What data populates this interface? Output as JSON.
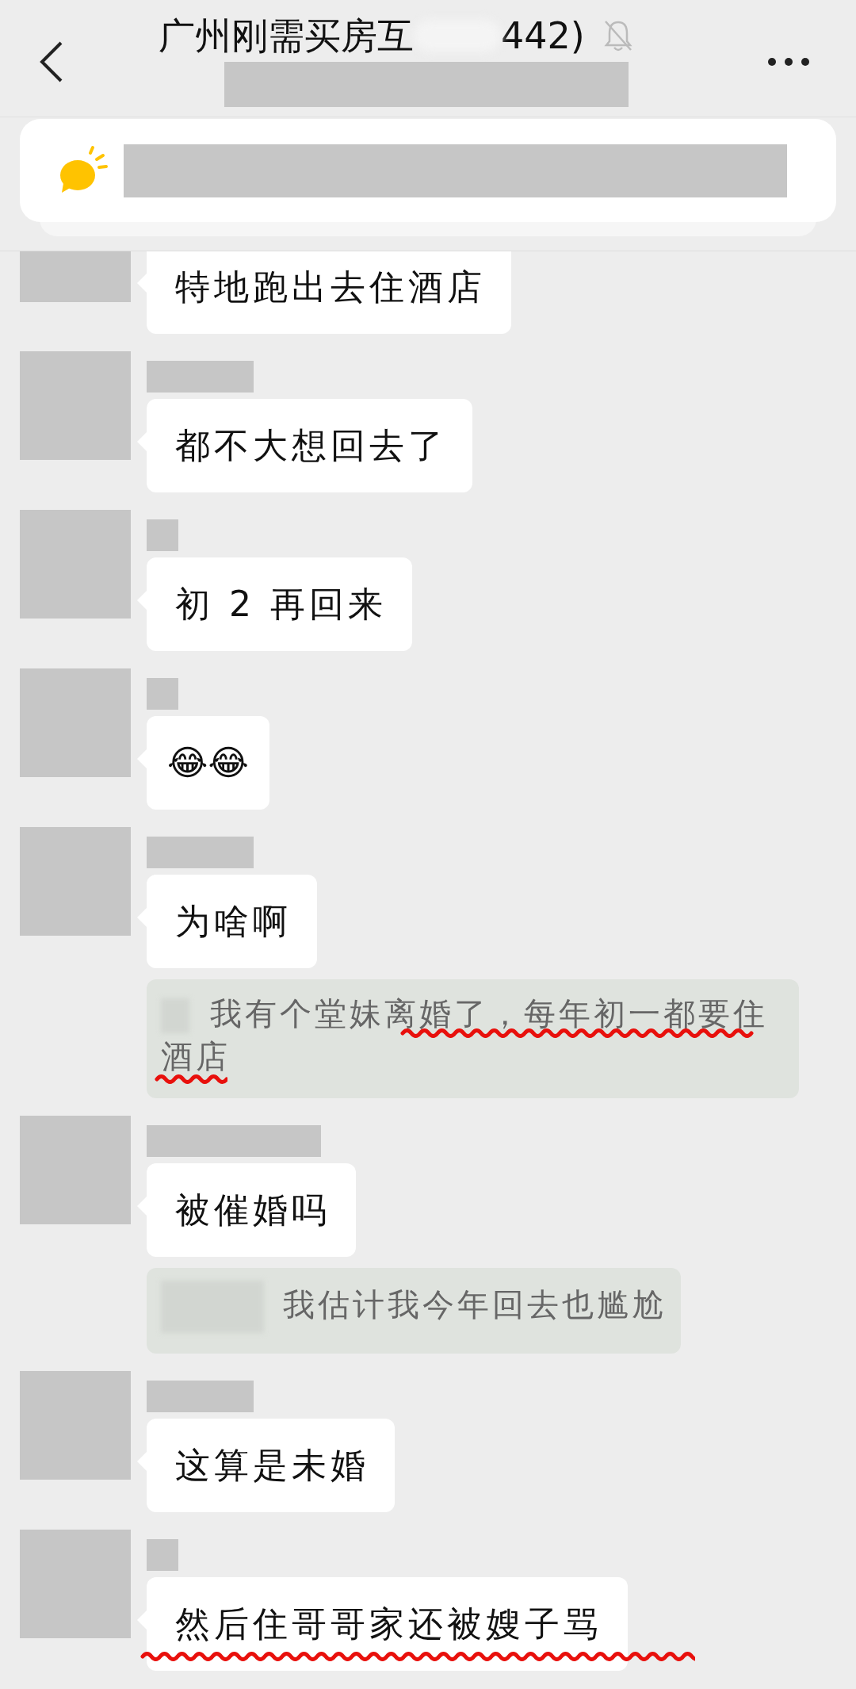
{
  "header": {
    "title": "广州刚需买房互",
    "member_count": "442)",
    "muted": true
  },
  "messages": [
    {
      "name_redacted": false,
      "kind": "text",
      "text": "特地跑出去住酒店",
      "red_underline": false
    },
    {
      "name_redacted": true,
      "kind": "text",
      "text": "都不大想回去了",
      "red_underline": false
    },
    {
      "name_redacted": true,
      "kind": "text",
      "text": "初 2 再回来",
      "red_underline": false
    },
    {
      "name_redacted": true,
      "kind": "emoji",
      "text": "😂😂",
      "red_underline": false
    },
    {
      "name_redacted": true,
      "kind": "text",
      "text": "为啥啊",
      "red_underline": false,
      "quote": {
        "text": "我有个堂妹离婚了，每年初一都要住酒店",
        "red_underline": true
      }
    },
    {
      "name_redacted": true,
      "kind": "text",
      "text": "被催婚吗",
      "red_underline": false,
      "quote": {
        "text": "我估计我今年回去也尴尬",
        "red_underline": false
      }
    },
    {
      "name_redacted": true,
      "kind": "text",
      "text": "这算是未婚",
      "red_underline": false
    },
    {
      "name_redacted": true,
      "kind": "text",
      "text": "然后住哥哥家还被嫂子骂",
      "red_underline": true
    }
  ]
}
